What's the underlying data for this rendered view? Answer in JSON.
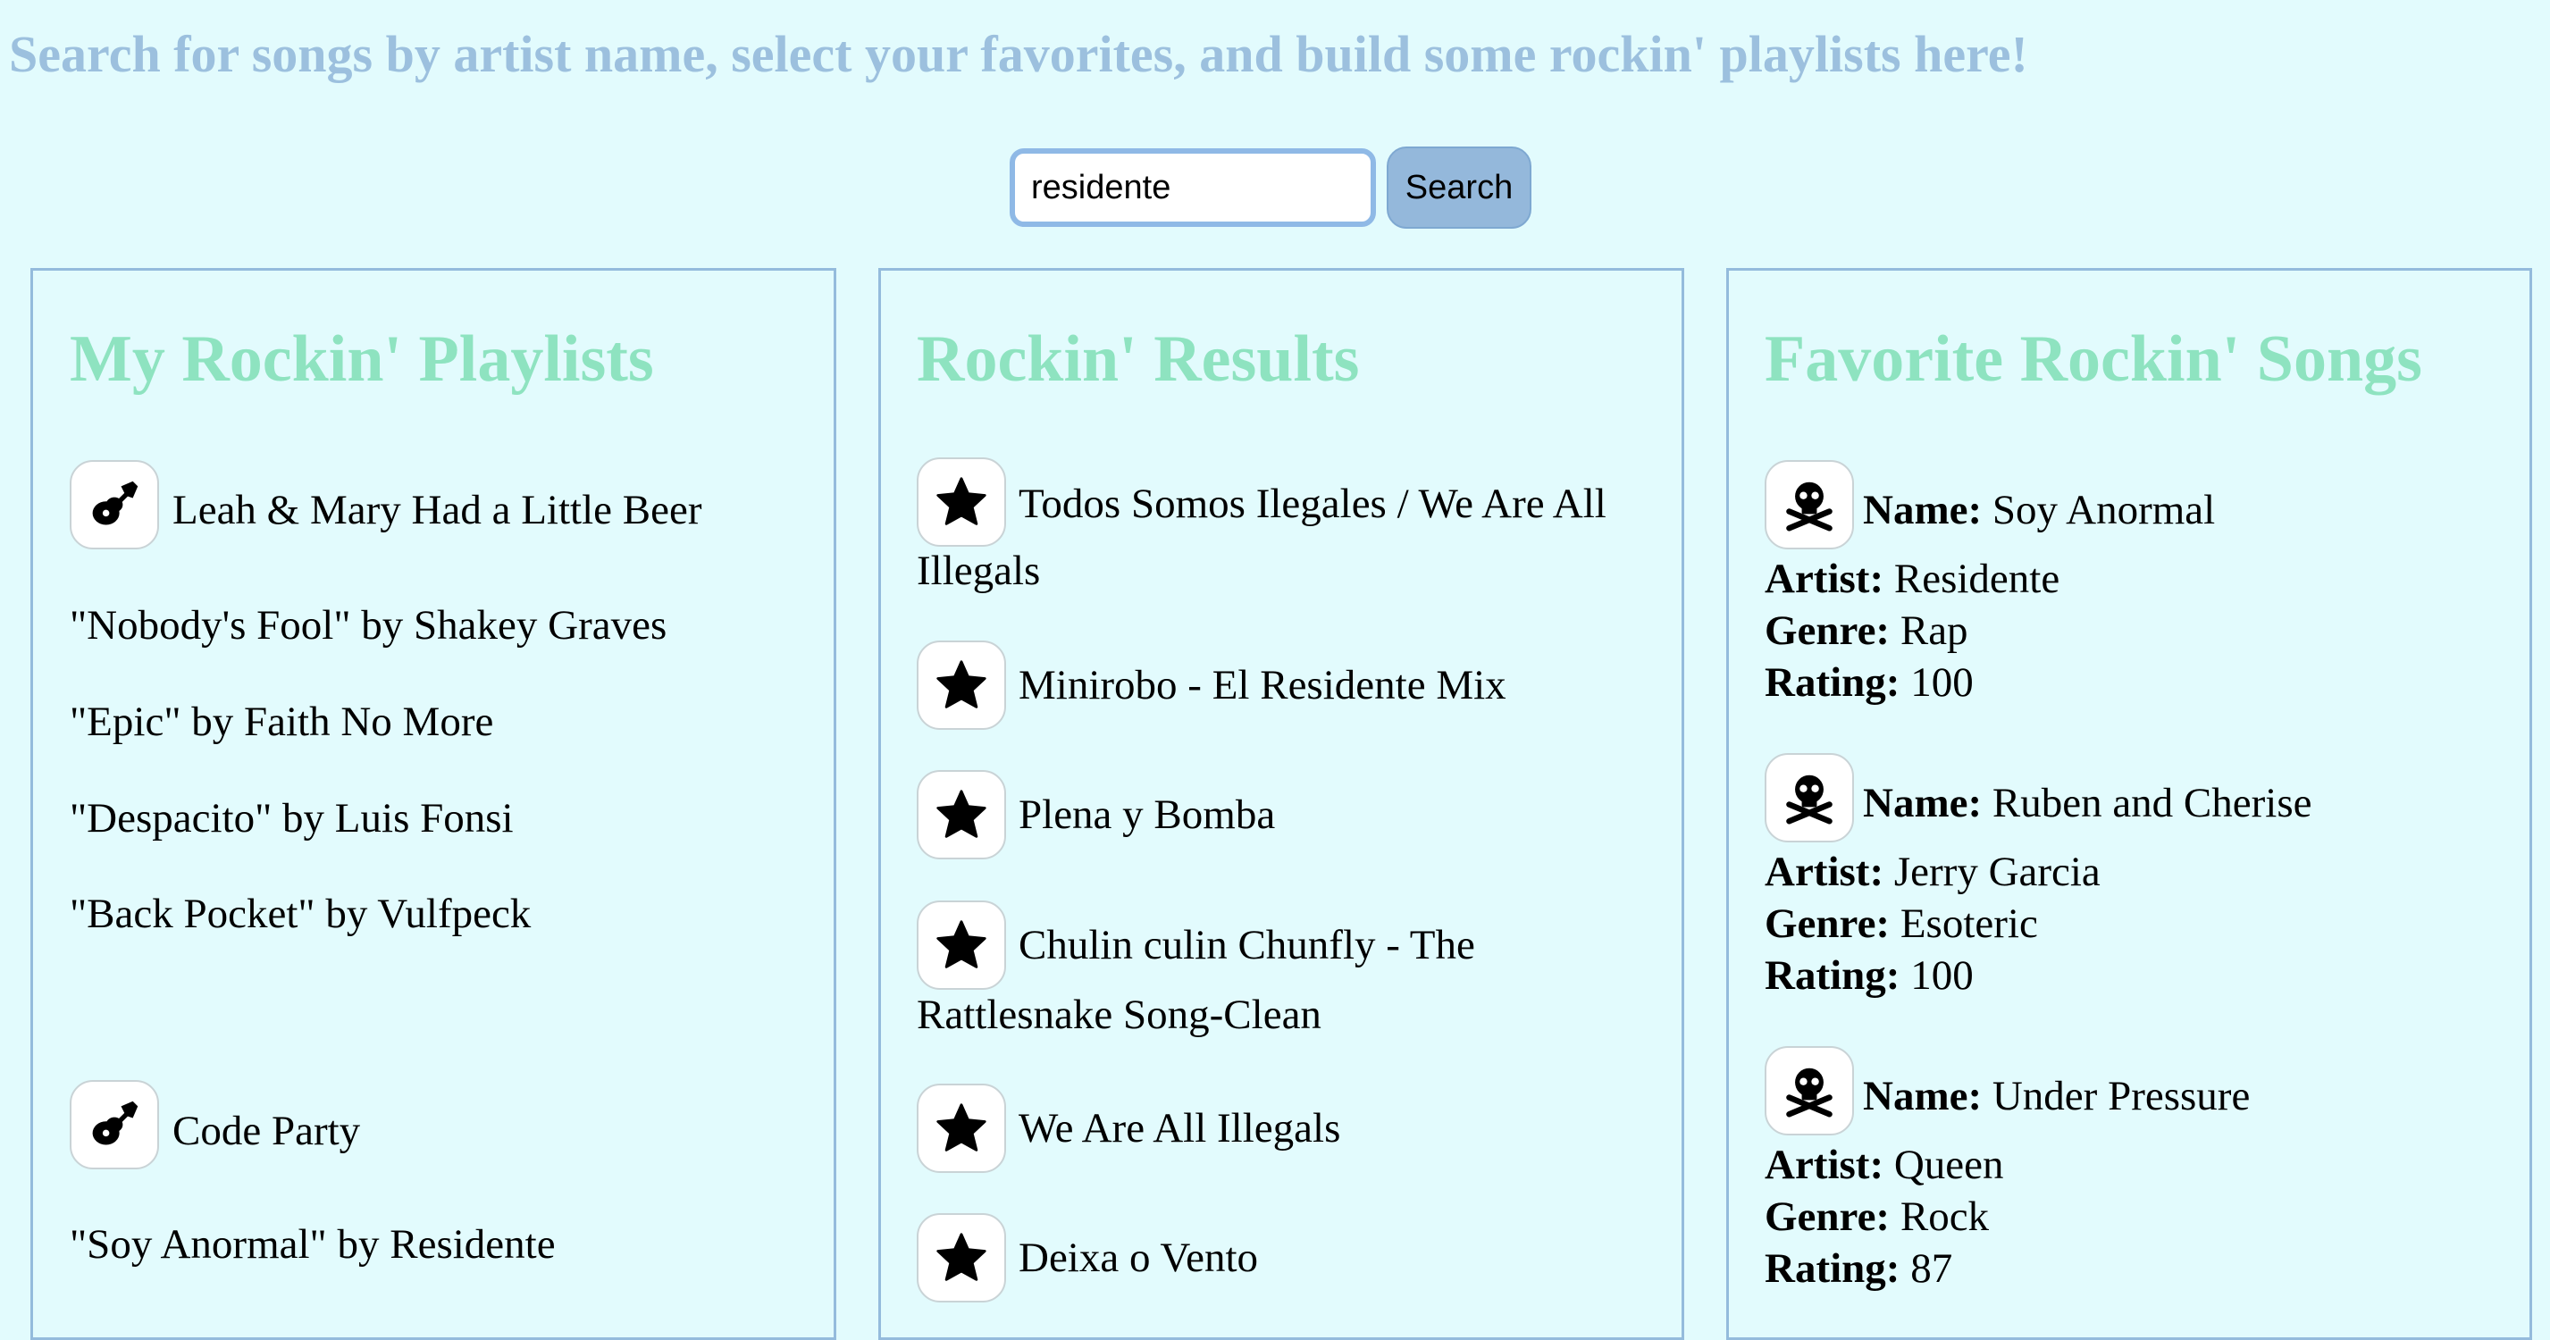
{
  "header": {
    "tagline": "Search for songs by artist name, select your favorites, and build some rockin' playlists here!"
  },
  "search": {
    "value": "residente",
    "button_label": "Search"
  },
  "playlists": {
    "title": "My Rockin' Playlists",
    "items": [
      {
        "name": "Leah & Mary Had a Little Beer",
        "icon": "guitar-icon",
        "songs": [
          "\"Nobody's Fool\" by Shakey Graves",
          "\"Epic\" by Faith No More",
          "\"Despacito\" by Luis Fonsi",
          "\"Back Pocket\" by Vulfpeck"
        ]
      },
      {
        "name": "Code Party",
        "icon": "guitar-icon",
        "songs": [
          "\"Soy Anormal\" by Residente"
        ]
      }
    ]
  },
  "results": {
    "title": "Rockin' Results",
    "items": [
      {
        "line1": "Todos Somos Ilegales / We Are All",
        "line2": "Illegals",
        "icon": "star-icon"
      },
      {
        "line1": "Minirobo - El Residente Mix",
        "icon": "star-icon"
      },
      {
        "line1": "Plena y Bomba",
        "icon": "star-icon"
      },
      {
        "line1": "Chulin culin Chunfly - The",
        "line2": "Rattlesnake Song-Clean",
        "icon": "star-icon"
      },
      {
        "line1": "We Are All Illegals",
        "icon": "star-icon"
      },
      {
        "line1": "Deixa o Vento",
        "icon": "star-icon"
      }
    ]
  },
  "favorites": {
    "title": "Favorite Rockin' Songs",
    "labels": {
      "name": "Name:",
      "artist": "Artist:",
      "genre": "Genre:",
      "rating": "Rating:"
    },
    "items": [
      {
        "name": "Soy Anormal",
        "artist": "Residente",
        "genre": "Rap",
        "rating": "100",
        "icon": "skull-crossbones-icon"
      },
      {
        "name": "Ruben and Cherise",
        "artist": "Jerry Garcia",
        "genre": "Esoteric",
        "rating": "100",
        "icon": "skull-crossbones-icon"
      },
      {
        "name": "Under Pressure",
        "artist": "Queen",
        "genre": "Rock",
        "rating": "87",
        "icon": "skull-crossbones-icon"
      }
    ]
  },
  "colors": {
    "background": "#e2fbfd",
    "headline": "#9cc0de",
    "panel_title": "#8ee3c0",
    "panel_border": "#94bbdc",
    "input_border": "#8fb9e6",
    "button": "#94b8db"
  }
}
